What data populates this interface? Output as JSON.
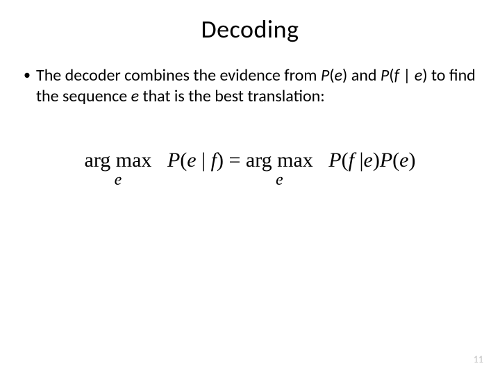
{
  "title": "Decoding",
  "bullet": {
    "pre": "The decoder combines the evidence from ",
    "pe_P": "P",
    "pe_open": "(",
    "pe_e": "e",
    "pe_close": ")",
    "and": " and ",
    "pfe_P": "P",
    "pfe_open": "(",
    "pfe_f": "f",
    "pfe_bar": " | ",
    "pfe_e": "e",
    "pfe_close": ")",
    "mid": " to find the sequence ",
    "seq_e": "e",
    "post": " that is the best translation:"
  },
  "formula": {
    "argmax1": "arg max",
    "sub1": "e",
    "P1": "P",
    "open1": "(",
    "e1": "e",
    "bar1": " | ",
    "f1": "f",
    "close1": ")",
    "eq": " = ",
    "argmax2": "arg max",
    "sub2": "e",
    "P2": "P",
    "open2": "(",
    "f2": "f",
    "bar2": " |",
    "e2": "e",
    "close2": ")",
    "P3": "P",
    "open3": "(",
    "e3": "e",
    "close3": ")"
  },
  "page_number": "11"
}
